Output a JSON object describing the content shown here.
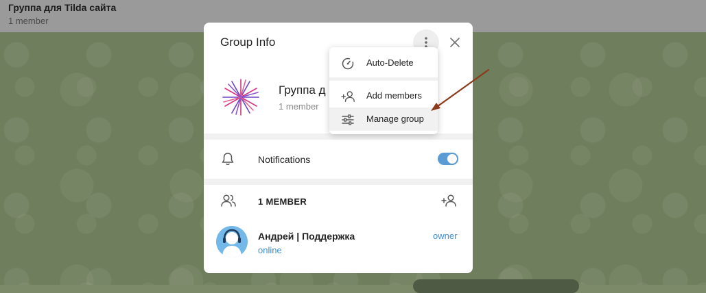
{
  "chat_header": {
    "title": "Группа для Tilda сайта",
    "subtitle": "1 member"
  },
  "dialog": {
    "title": "Group Info",
    "group_name": "Группа д",
    "group_member_count": "1 member",
    "notifications_label": "Notifications",
    "notifications_enabled": true,
    "members_header": "1 MEMBER",
    "member": {
      "name": "Андрей | Поддержка",
      "status": "online",
      "role": "owner"
    }
  },
  "menu": {
    "items": [
      {
        "label": "Auto-Delete",
        "icon": "timer-icon"
      },
      {
        "label": "Add members",
        "icon": "add-user-icon"
      },
      {
        "label": "Manage group",
        "icon": "sliders-icon"
      }
    ]
  },
  "colors": {
    "accent": "#5b9bd5",
    "link": "#3d8fd1",
    "arrow": "#8b3a1a"
  }
}
